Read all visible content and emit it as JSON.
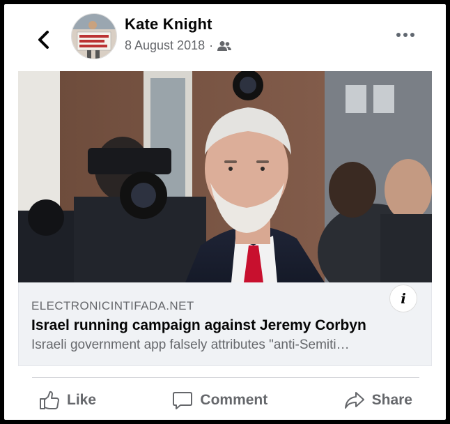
{
  "post": {
    "author": "Kate Knight",
    "date": "8 August 2018",
    "separator": "·",
    "audience_icon": "friends-icon"
  },
  "link_preview": {
    "domain": "ELECTRONICINTIFADA.NET",
    "title": "Israel running campaign against Jeremy Corbyn",
    "description": "Israeli government app falsely attributes \"anti-Semiti…"
  },
  "actions": {
    "like": "Like",
    "comment": "Comment",
    "share": "Share"
  },
  "colors": {
    "text_primary": "#050505",
    "text_secondary": "#65676b",
    "link_box_bg": "#f0f2f5",
    "tie_red": "#c8102e"
  }
}
